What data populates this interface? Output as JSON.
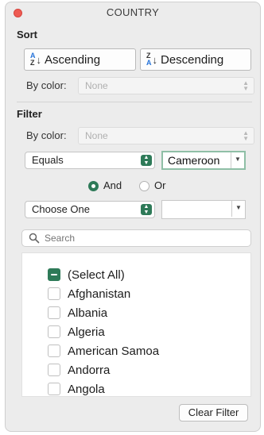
{
  "window": {
    "title": "COUNTRY"
  },
  "sort": {
    "heading": "Sort",
    "ascending_label": "Ascending",
    "descending_label": "Descending",
    "ascending_glyph_top": "A",
    "ascending_glyph_bottom": "Z",
    "descending_glyph_top": "Z",
    "descending_glyph_bottom": "A",
    "by_color_label": "By color:",
    "by_color_value": "None"
  },
  "filter": {
    "heading": "Filter",
    "by_color_label": "By color:",
    "by_color_value": "None",
    "condition1": {
      "operator": "Equals",
      "value": "Cameroon"
    },
    "logic": {
      "and_label": "And",
      "or_label": "Or",
      "selected": "And"
    },
    "condition2": {
      "operator": "Choose One",
      "value": ""
    }
  },
  "search": {
    "placeholder": "Search"
  },
  "list": {
    "items": [
      {
        "label": "(Select All)",
        "state": "mixed"
      },
      {
        "label": "Afghanistan",
        "state": "unchecked"
      },
      {
        "label": "Albania",
        "state": "unchecked"
      },
      {
        "label": "Algeria",
        "state": "unchecked"
      },
      {
        "label": "American Samoa",
        "state": "unchecked"
      },
      {
        "label": "Andorra",
        "state": "unchecked"
      },
      {
        "label": "Angola",
        "state": "unchecked"
      }
    ]
  },
  "actions": {
    "clear_filter_label": "Clear Filter"
  },
  "colors": {
    "accent": "#2e7a58",
    "close": "#ee5b53",
    "sort_icon_blue": "#2673d9"
  }
}
